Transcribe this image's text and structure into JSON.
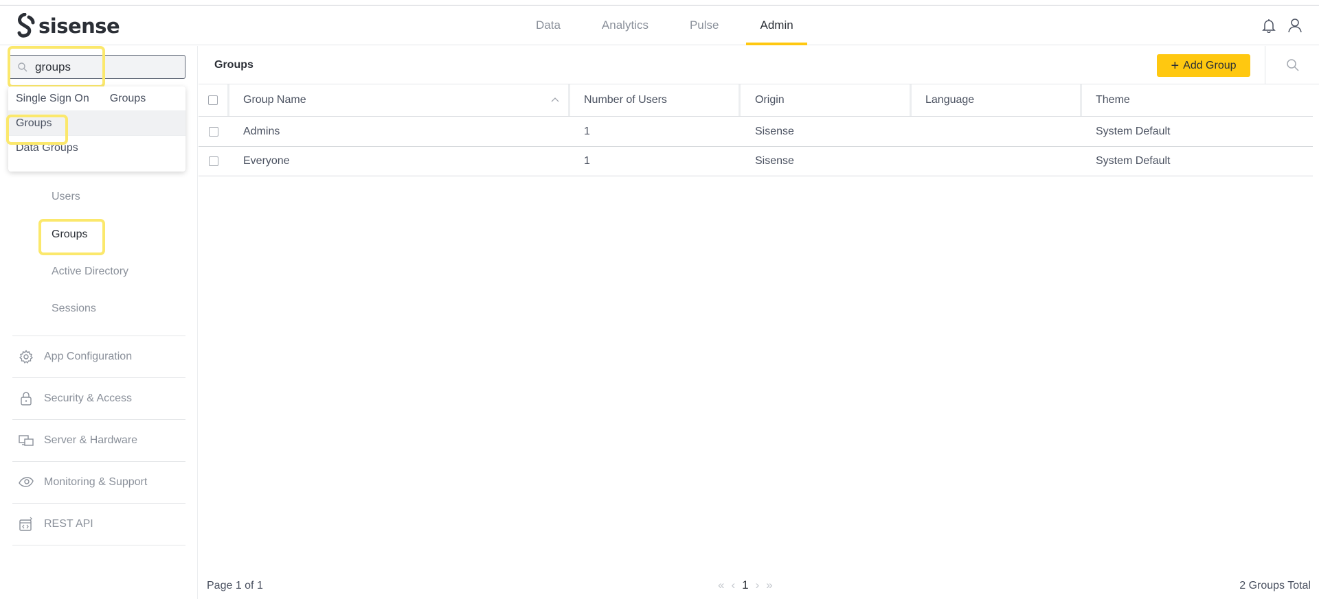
{
  "app": {
    "brand": "sisense"
  },
  "nav": {
    "tabs": [
      "Data",
      "Analytics",
      "Pulse",
      "Admin"
    ],
    "active": "Admin"
  },
  "colors": {
    "accent": "#ffc810",
    "highlight": "#fbe86c",
    "text_dark": "#2b2f36",
    "text_muted": "#8a909a"
  },
  "sidebar": {
    "search": {
      "value": "groups"
    },
    "dropdown": {
      "rows": [
        {
          "label": "Single Sign On",
          "sub": "Groups"
        },
        {
          "label": "Groups"
        },
        {
          "label": "Data Groups"
        }
      ]
    },
    "sub_items": [
      "Users",
      "Groups",
      "Active Directory",
      "Sessions"
    ],
    "sections": [
      {
        "label": "App Configuration",
        "icon": "gear-icon"
      },
      {
        "label": "Security & Access",
        "icon": "lock-icon"
      },
      {
        "label": "Server & Hardware",
        "icon": "server-icon"
      },
      {
        "label": "Monitoring & Support",
        "icon": "eye-icon"
      },
      {
        "label": "REST API",
        "icon": "api-icon"
      }
    ]
  },
  "main": {
    "title": "Groups",
    "add_button": "Add Group",
    "columns": [
      "Group Name",
      "Number of Users",
      "Origin",
      "Language",
      "Theme"
    ],
    "rows": [
      {
        "name": "Admins",
        "users": "1",
        "origin": "Sisense",
        "language": "",
        "theme": "System Default"
      },
      {
        "name": "Everyone",
        "users": "1",
        "origin": "Sisense",
        "language": "",
        "theme": "System Default"
      }
    ],
    "footer": {
      "page_info": "Page 1 of 1",
      "current_page": "1",
      "total": "2 Groups Total"
    }
  }
}
